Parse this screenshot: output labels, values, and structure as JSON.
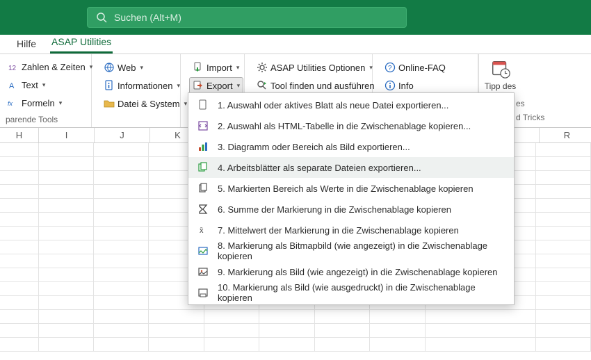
{
  "search": {
    "placeholder": "Suchen (Alt+M)"
  },
  "tabs": {
    "help": "Hilfe",
    "asap": "ASAP Utilities"
  },
  "ribbon": {
    "g1": {
      "numbers": "Zahlen & Zeiten",
      "text": "Text",
      "formulas": "Formeln"
    },
    "g2": {
      "web": "Web",
      "info": "Informationen",
      "file": "Datei & System"
    },
    "g3": {
      "import": "Import",
      "export": "Export"
    },
    "g4": {
      "options": "ASAP Utilities Optionen",
      "find": "Tool finden und ausführen"
    },
    "g5": {
      "faq": "Online-FAQ",
      "info": "Info"
    },
    "g1_label": "parende Tools",
    "tipp_top": "Tipp des",
    "tipp_frag1": "es",
    "tipp_frag2": "d Tricks"
  },
  "menu": {
    "i1": "1. Auswahl oder aktives Blatt als neue Datei exportieren...",
    "i2": "2. Auswahl als HTML-Tabelle in die Zwischenablage kopieren...",
    "i3": "3. Diagramm oder Bereich als Bild exportieren...",
    "i4": "4. Arbeitsblätter als separate Dateien exportieren...",
    "i5": "5. Markierten Bereich als Werte in die Zwischenablage kopieren",
    "i6": "6. Summe der Markierung in die Zwischenablage kopieren",
    "i7": "7. Mittelwert der Markierung in die Zwischenablage kopieren",
    "i8": "8. Markierung als Bitmapbild (wie angezeigt) in die Zwischenablage kopieren",
    "i9": "9. Markierung als Bild (wie angezeigt) in die Zwischenablage kopieren",
    "i10": "10. Markierung als Bild (wie ausgedruckt) in die Zwischenablage kopieren"
  },
  "cols": [
    "H",
    "I",
    "J",
    "K",
    "",
    "",
    "",
    "",
    "",
    "R"
  ]
}
